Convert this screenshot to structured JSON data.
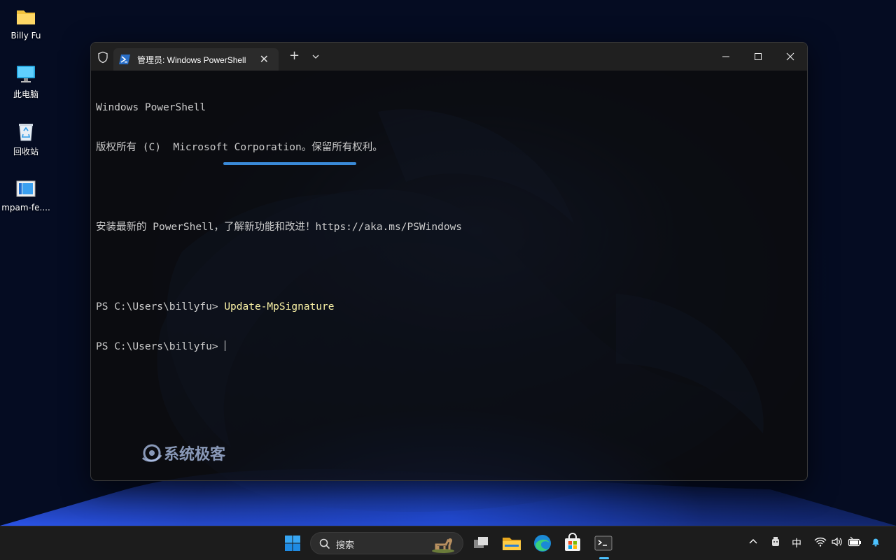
{
  "desktop": {
    "icons": [
      {
        "label": "Billy Fu",
        "icon": "folder-icon"
      },
      {
        "label": "此电脑",
        "icon": "this-pc-icon"
      },
      {
        "label": "回收站",
        "icon": "recycle-bin-icon"
      },
      {
        "label": "mpam-fe....",
        "icon": "installer-file-icon"
      }
    ]
  },
  "window": {
    "tab_title": "管理员: Windows PowerShell",
    "new_tab": "+",
    "close_tab": "✕"
  },
  "console": {
    "lines": [
      "Windows PowerShell",
      "版权所有 (C)  Microsoft Corporation。保留所有权利。",
      "",
      "安装最新的 PowerShell，了解新功能和改进！https://aka.ms/PSWindows",
      ""
    ],
    "prompt1": "PS C:\\Users\\billyfu> ",
    "command": "Update-MpSignature",
    "prompt2": "PS C:\\Users\\billyfu>"
  },
  "watermark": "系统极客",
  "taskbar": {
    "search_placeholder": "搜索",
    "ime": "中"
  },
  "colors": {
    "accent": "#4cc2ff",
    "command_text": "#f9f1a5",
    "underline": "#3a8ad8"
  }
}
